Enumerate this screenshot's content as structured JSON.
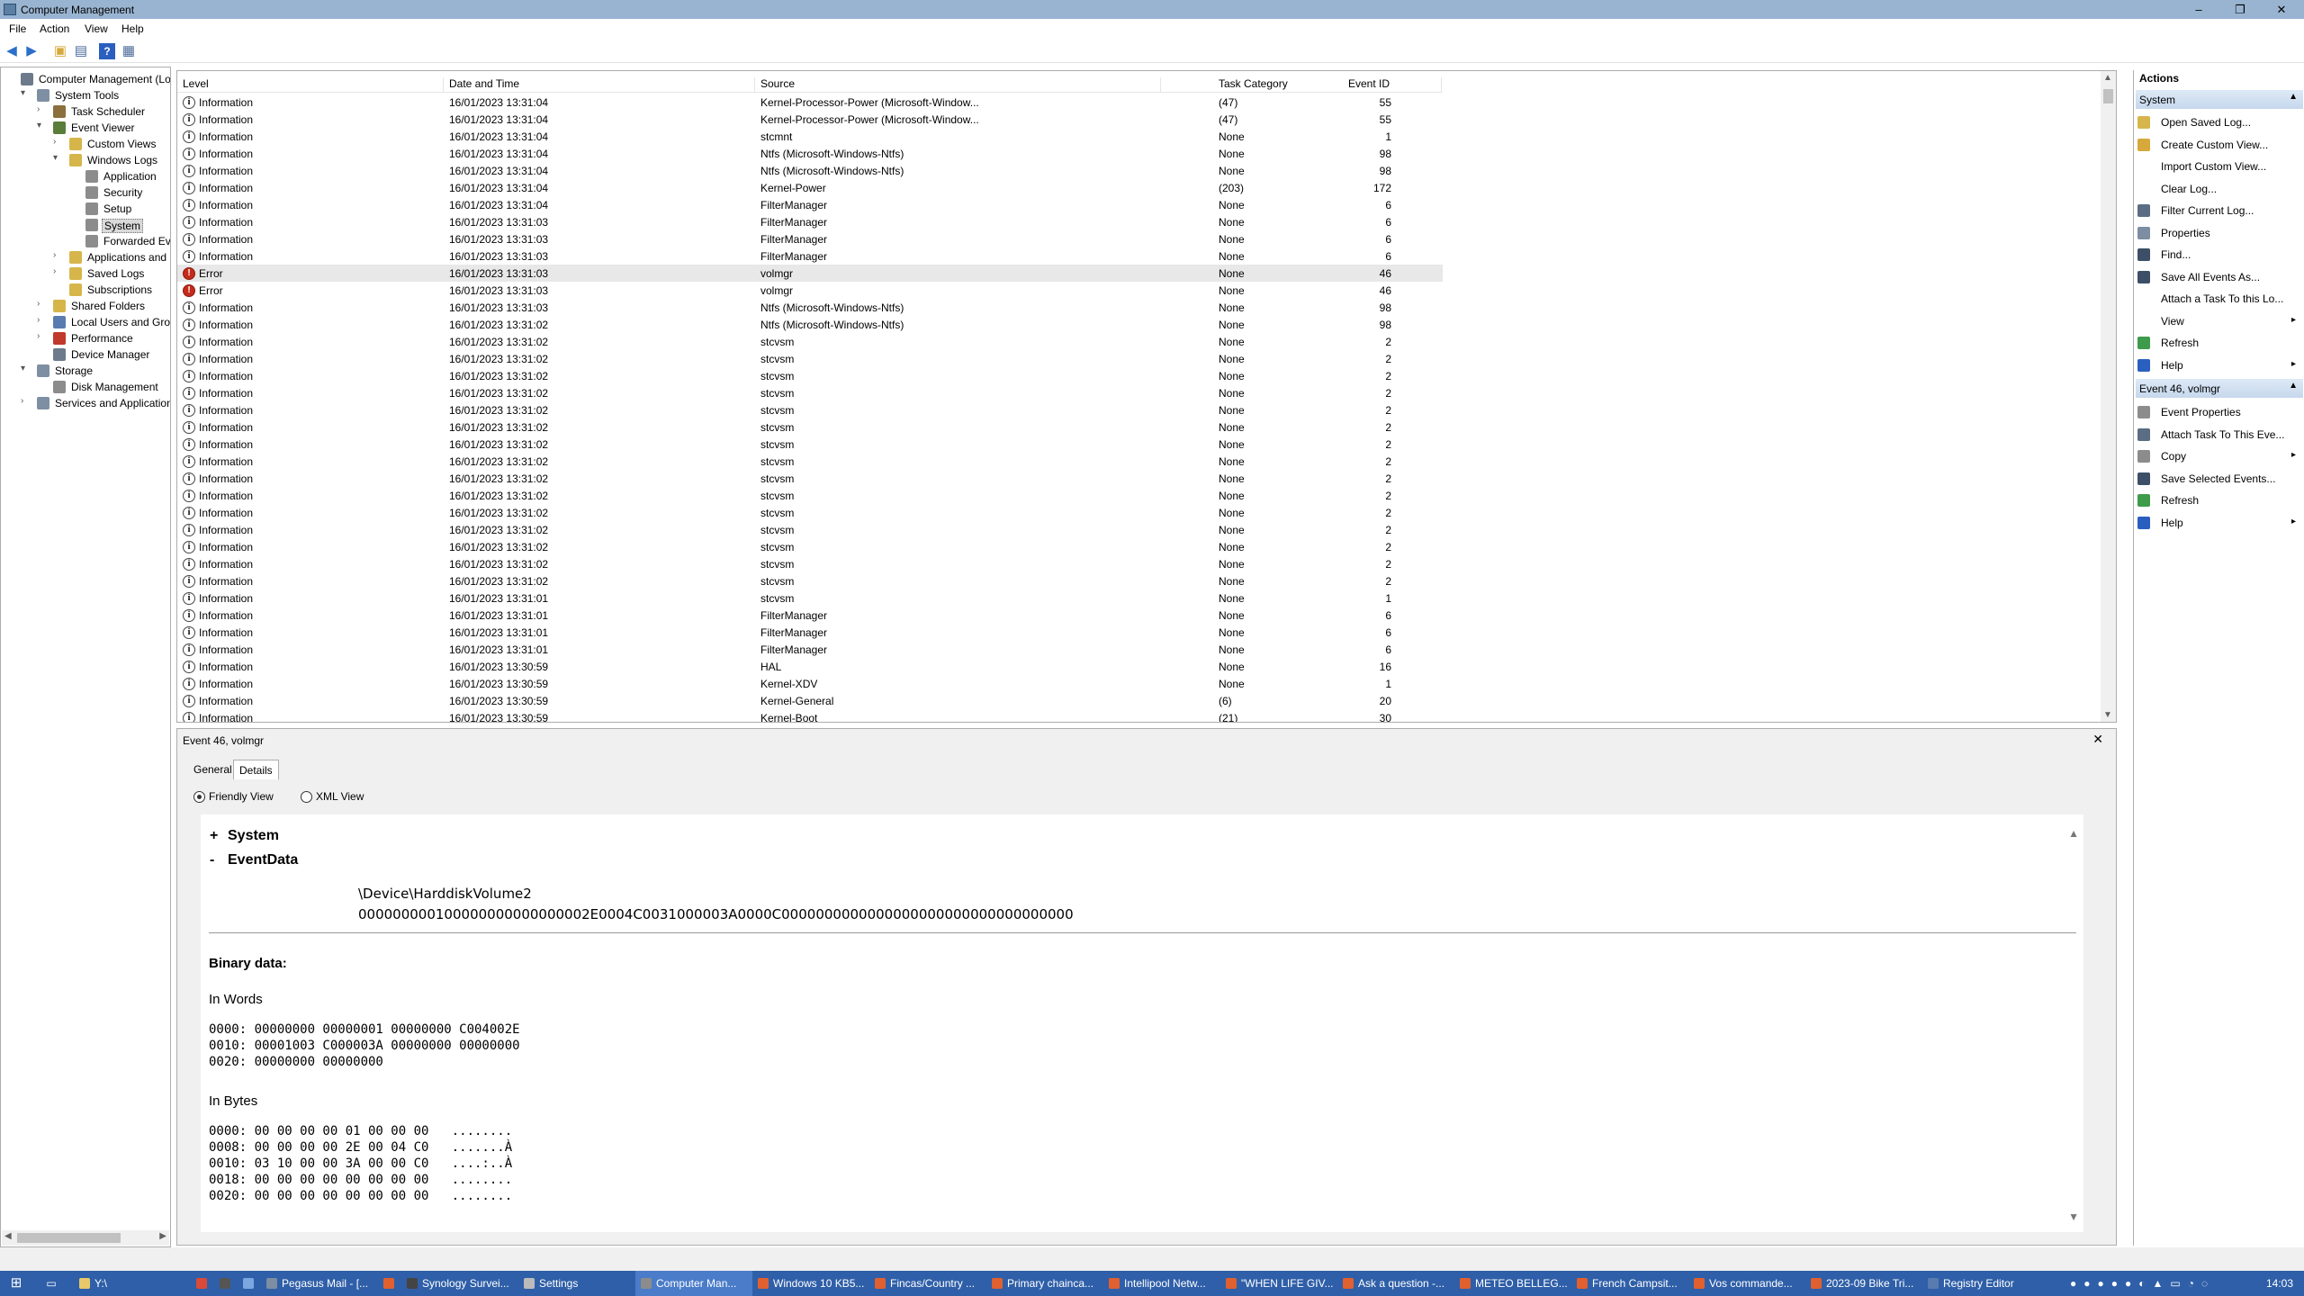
{
  "window": {
    "title": "Computer Management",
    "minimize": "–",
    "maximize": "❐",
    "close": "✕"
  },
  "menu": [
    "File",
    "Action",
    "View",
    "Help"
  ],
  "tree": [
    {
      "label": "Computer Management (Local",
      "indent": 0,
      "exp": "",
      "color": "#6c7a8c"
    },
    {
      "label": "System Tools",
      "indent": 1,
      "exp": "▾",
      "color": "#7f8fa3"
    },
    {
      "label": "Task Scheduler",
      "indent": 2,
      "exp": "›",
      "color": "#8b6f3c"
    },
    {
      "label": "Event Viewer",
      "indent": 2,
      "exp": "▾",
      "color": "#5b7d3a"
    },
    {
      "label": "Custom Views",
      "indent": 3,
      "exp": "›",
      "color": "#d6b64a"
    },
    {
      "label": "Windows Logs",
      "indent": 3,
      "exp": "▾",
      "color": "#d6b64a"
    },
    {
      "label": "Application",
      "indent": 4,
      "exp": "",
      "color": "#8c8c8c"
    },
    {
      "label": "Security",
      "indent": 4,
      "exp": "",
      "color": "#8c8c8c"
    },
    {
      "label": "Setup",
      "indent": 4,
      "exp": "",
      "color": "#8c8c8c"
    },
    {
      "label": "System",
      "indent": 4,
      "exp": "",
      "color": "#8c8c8c",
      "selected": true
    },
    {
      "label": "Forwarded Event",
      "indent": 4,
      "exp": "",
      "color": "#8c8c8c"
    },
    {
      "label": "Applications and Se",
      "indent": 3,
      "exp": "›",
      "color": "#d6b64a"
    },
    {
      "label": "Saved Logs",
      "indent": 3,
      "exp": "›",
      "color": "#d6b64a"
    },
    {
      "label": "Subscriptions",
      "indent": 3,
      "exp": "",
      "color": "#d6b64a"
    },
    {
      "label": "Shared Folders",
      "indent": 2,
      "exp": "›",
      "color": "#d6b64a"
    },
    {
      "label": "Local Users and Groups",
      "indent": 2,
      "exp": "›",
      "color": "#5a7bb0"
    },
    {
      "label": "Performance",
      "indent": 2,
      "exp": "›",
      "color": "#c0392b"
    },
    {
      "label": "Device Manager",
      "indent": 2,
      "exp": "",
      "color": "#6c7a8c"
    },
    {
      "label": "Storage",
      "indent": 1,
      "exp": "▾",
      "color": "#7f8fa3"
    },
    {
      "label": "Disk Management",
      "indent": 2,
      "exp": "",
      "color": "#8c8c8c"
    },
    {
      "label": "Services and Applications",
      "indent": 1,
      "exp": "›",
      "color": "#7f8fa3"
    }
  ],
  "events": {
    "columns": [
      "Level",
      "Date and Time",
      "Source",
      "Event ID",
      "Task Category"
    ],
    "rows": [
      [
        "Information",
        "16/01/2023 13:31:04",
        "Kernel-Processor-Power (Microsoft-Window...",
        "55",
        "(47)"
      ],
      [
        "Information",
        "16/01/2023 13:31:04",
        "Kernel-Processor-Power (Microsoft-Window...",
        "55",
        "(47)"
      ],
      [
        "Information",
        "16/01/2023 13:31:04",
        "stcmnt",
        "1",
        "None"
      ],
      [
        "Information",
        "16/01/2023 13:31:04",
        "Ntfs (Microsoft-Windows-Ntfs)",
        "98",
        "None"
      ],
      [
        "Information",
        "16/01/2023 13:31:04",
        "Ntfs (Microsoft-Windows-Ntfs)",
        "98",
        "None"
      ],
      [
        "Information",
        "16/01/2023 13:31:04",
        "Kernel-Power",
        "172",
        "(203)"
      ],
      [
        "Information",
        "16/01/2023 13:31:04",
        "FilterManager",
        "6",
        "None"
      ],
      [
        "Information",
        "16/01/2023 13:31:03",
        "FilterManager",
        "6",
        "None"
      ],
      [
        "Information",
        "16/01/2023 13:31:03",
        "FilterManager",
        "6",
        "None"
      ],
      [
        "Information",
        "16/01/2023 13:31:03",
        "FilterManager",
        "6",
        "None"
      ],
      [
        "Error",
        "16/01/2023 13:31:03",
        "volmgr",
        "46",
        "None"
      ],
      [
        "Error",
        "16/01/2023 13:31:03",
        "volmgr",
        "46",
        "None"
      ],
      [
        "Information",
        "16/01/2023 13:31:03",
        "Ntfs (Microsoft-Windows-Ntfs)",
        "98",
        "None"
      ],
      [
        "Information",
        "16/01/2023 13:31:02",
        "Ntfs (Microsoft-Windows-Ntfs)",
        "98",
        "None"
      ],
      [
        "Information",
        "16/01/2023 13:31:02",
        "stcvsm",
        "2",
        "None"
      ],
      [
        "Information",
        "16/01/2023 13:31:02",
        "stcvsm",
        "2",
        "None"
      ],
      [
        "Information",
        "16/01/2023 13:31:02",
        "stcvsm",
        "2",
        "None"
      ],
      [
        "Information",
        "16/01/2023 13:31:02",
        "stcvsm",
        "2",
        "None"
      ],
      [
        "Information",
        "16/01/2023 13:31:02",
        "stcvsm",
        "2",
        "None"
      ],
      [
        "Information",
        "16/01/2023 13:31:02",
        "stcvsm",
        "2",
        "None"
      ],
      [
        "Information",
        "16/01/2023 13:31:02",
        "stcvsm",
        "2",
        "None"
      ],
      [
        "Information",
        "16/01/2023 13:31:02",
        "stcvsm",
        "2",
        "None"
      ],
      [
        "Information",
        "16/01/2023 13:31:02",
        "stcvsm",
        "2",
        "None"
      ],
      [
        "Information",
        "16/01/2023 13:31:02",
        "stcvsm",
        "2",
        "None"
      ],
      [
        "Information",
        "16/01/2023 13:31:02",
        "stcvsm",
        "2",
        "None"
      ],
      [
        "Information",
        "16/01/2023 13:31:02",
        "stcvsm",
        "2",
        "None"
      ],
      [
        "Information",
        "16/01/2023 13:31:02",
        "stcvsm",
        "2",
        "None"
      ],
      [
        "Information",
        "16/01/2023 13:31:02",
        "stcvsm",
        "2",
        "None"
      ],
      [
        "Information",
        "16/01/2023 13:31:02",
        "stcvsm",
        "2",
        "None"
      ],
      [
        "Information",
        "16/01/2023 13:31:01",
        "stcvsm",
        "1",
        "None"
      ],
      [
        "Information",
        "16/01/2023 13:31:01",
        "FilterManager",
        "6",
        "None"
      ],
      [
        "Information",
        "16/01/2023 13:31:01",
        "FilterManager",
        "6",
        "None"
      ],
      [
        "Information",
        "16/01/2023 13:31:01",
        "FilterManager",
        "6",
        "None"
      ],
      [
        "Information",
        "16/01/2023 13:30:59",
        "HAL",
        "16",
        "None"
      ],
      [
        "Information",
        "16/01/2023 13:30:59",
        "Kernel-XDV",
        "1",
        "None"
      ],
      [
        "Information",
        "16/01/2023 13:30:59",
        "Kernel-General",
        "20",
        "(6)"
      ],
      [
        "Information",
        "16/01/2023 13:30:59",
        "Kernel-Boot",
        "30",
        "(21)"
      ]
    ],
    "selected_row": 10
  },
  "detail": {
    "title": "Event 46, volmgr",
    "close": "✕",
    "tabs": [
      "General",
      "Details"
    ],
    "radio_friendly": "Friendly View",
    "radio_xml": "XML View",
    "sys_expander": "+",
    "sys_label": "System",
    "ev_expander": "-",
    "ev_label": "EventData",
    "ev_line1": "\\Device\\HarddiskVolume2",
    "ev_line2": "000000000100000000000000002E0004C0031000003A0000C0000000000000000000000000000000000",
    "binary_label": "Binary data:",
    "words_label": "In Words",
    "words": "0000: 00000000 00000001 00000000 C004002E\n0010: 00001003 C000003A 00000000 00000000\n0020: 00000000 00000000",
    "bytes_label": "In Bytes",
    "bytes": "0000: 00 00 00 00 01 00 00 00   ........\n0008: 00 00 00 00 2E 00 04 C0   .......À\n0010: 03 10 00 00 3A 00 00 C0   ....:..À\n0018: 00 00 00 00 00 00 00 00   ........\n0020: 00 00 00 00 00 00 00 00   ........"
  },
  "actions": {
    "header": "Actions",
    "group1": "System",
    "items1": [
      {
        "label": "Open Saved Log...",
        "color": "#d6b64a"
      },
      {
        "label": "Create Custom View...",
        "color": "#d6a93a"
      },
      {
        "label": "Import Custom View...",
        "color": "#ffffff"
      },
      {
        "label": "Clear Log...",
        "color": "#ffffff"
      },
      {
        "label": "Filter Current Log...",
        "color": "#5b6d82"
      },
      {
        "label": "Properties",
        "color": "#7d8ea3"
      },
      {
        "label": "Find...",
        "color": "#3d4f66"
      },
      {
        "label": "Save All Events As...",
        "color": "#3d4f66"
      },
      {
        "label": "Attach a Task To this Lo...",
        "color": "#ffffff"
      },
      {
        "label": "View",
        "color": "#ffffff",
        "sub": "▸"
      },
      {
        "label": "Refresh",
        "color": "#3f9b4c"
      },
      {
        "label": "Help",
        "color": "#2a5fbf",
        "sub": "▸"
      }
    ],
    "group2": "Event 46, volmgr",
    "items2": [
      {
        "label": "Event Properties",
        "color": "#8c8c8c"
      },
      {
        "label": "Attach Task To This Eve...",
        "color": "#5b6d82"
      },
      {
        "label": "Copy",
        "color": "#8c8c8c",
        "sub": "▸"
      },
      {
        "label": "Save Selected Events...",
        "color": "#3d4f66"
      },
      {
        "label": "Refresh",
        "color": "#3f9b4c"
      },
      {
        "label": "Help",
        "color": "#2a5fbf",
        "sub": "▸"
      }
    ]
  },
  "taskbar": {
    "items": [
      {
        "label": "Y:\\",
        "color": "#e8c86a"
      },
      {
        "label": "",
        "color": "#d94a3a"
      },
      {
        "label": "",
        "color": "#555555"
      },
      {
        "label": "",
        "color": "#7aa7e0"
      },
      {
        "label": "Pegasus Mail - [...",
        "color": "#7d8ea3"
      },
      {
        "label": "",
        "color": "#e06030"
      },
      {
        "label": "Synology Survei...",
        "color": "#444444"
      },
      {
        "label": "Settings",
        "color": "#bbbbbb"
      },
      {
        "label": "Computer Man...",
        "color": "#8c8c8c",
        "active": true
      },
      {
        "label": "Windows 10 KB5...",
        "color": "#e06030"
      },
      {
        "label": "Fincas/Country ...",
        "color": "#e06030"
      },
      {
        "label": "Primary chainca...",
        "color": "#e06030"
      },
      {
        "label": "Intellipool Netw...",
        "color": "#e06030"
      },
      {
        "label": "\"WHEN LIFE GIV...",
        "color": "#e06030"
      },
      {
        "label": "Ask a question -...",
        "color": "#e06030"
      },
      {
        "label": "METEO BELLEG...",
        "color": "#e06030"
      },
      {
        "label": "French Campsit...",
        "color": "#e06030"
      },
      {
        "label": "Vos commande...",
        "color": "#e06030"
      },
      {
        "label": "2023-09 Bike Tri...",
        "color": "#e06030"
      },
      {
        "label": "Registry Editor",
        "color": "#5a7bb0"
      }
    ],
    "clock": "14:03"
  }
}
